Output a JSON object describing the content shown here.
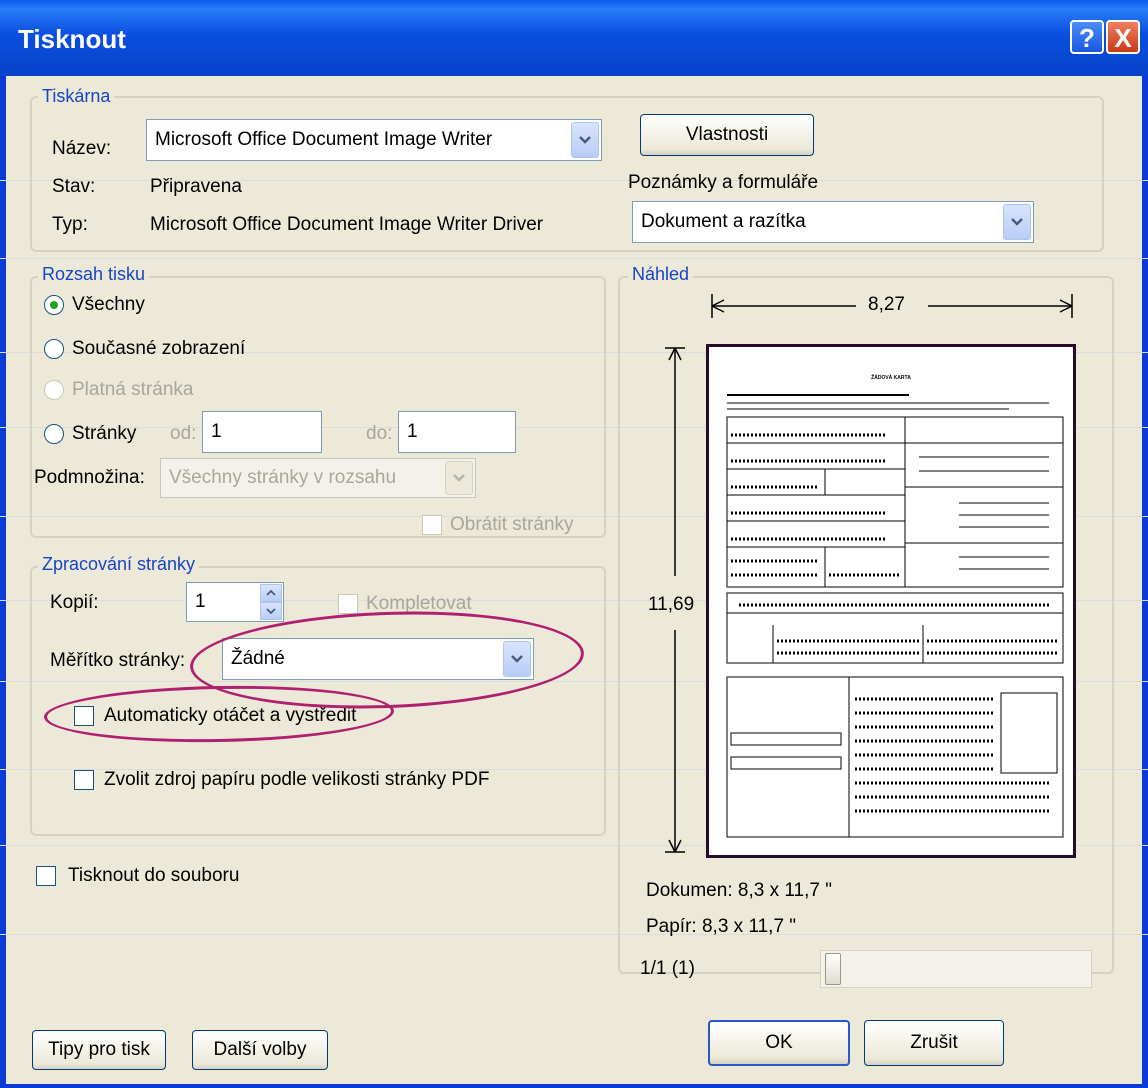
{
  "window": {
    "title": "Tisknout",
    "help_icon": "?",
    "close_icon": "X"
  },
  "printer": {
    "legend": "Tiskárna",
    "name_label": "Název:",
    "name_value": "Microsoft Office Document Image Writer",
    "status_label": "Stav:",
    "status_value": "Připravena",
    "type_label": "Typ:",
    "type_value": "Microsoft Office Document Image Writer Driver",
    "properties_button": "Vlastnosti",
    "comments_label": "Poznámky a formuláře",
    "comments_value": "Dokument a razítka"
  },
  "range": {
    "legend": "Rozsah tisku",
    "all": "Všechny",
    "current_view": "Současné zobrazení",
    "current_page": "Platná stránka",
    "pages": "Stránky",
    "from_label": "od:",
    "from_value": "1",
    "to_label": "do:",
    "to_value": "1",
    "subset_label": "Podmnožina:",
    "subset_value": "Všechny stránky v rozsahu",
    "reverse_pages": "Obrátit stránky"
  },
  "handling": {
    "legend": "Zpracování stránky",
    "copies_label": "Kopií:",
    "copies_value": "1",
    "collate": "Kompletovat",
    "scaling_label": "Měřítko stránky:",
    "scaling_value": "Žádné",
    "auto_rotate": "Automaticky otáčet a vystředit",
    "choose_paper": "Zvolit zdroj papíru podle velikosti stránky PDF"
  },
  "print_to_file": "Tisknout do souboru",
  "preview": {
    "legend": "Náhled",
    "width": "8,27",
    "height": "11,69",
    "document_size": "Dokumen: 8,3 x 11,7 \"",
    "paper_size": "Papír: 8,3 x 11,7 \"",
    "page_indicator": "1/1 (1)",
    "page_heading": "ŽÁDOVÁ KARTA"
  },
  "buttons": {
    "tips": "Tipy pro tisk",
    "more_options": "Další volby",
    "ok": "OK",
    "cancel": "Zrušit"
  },
  "colors": {
    "titlebar": "#0842c8",
    "accent_label": "#1845c8",
    "highlight_ellipse": "#b02070",
    "dialog_bg": "#ece9d8"
  }
}
